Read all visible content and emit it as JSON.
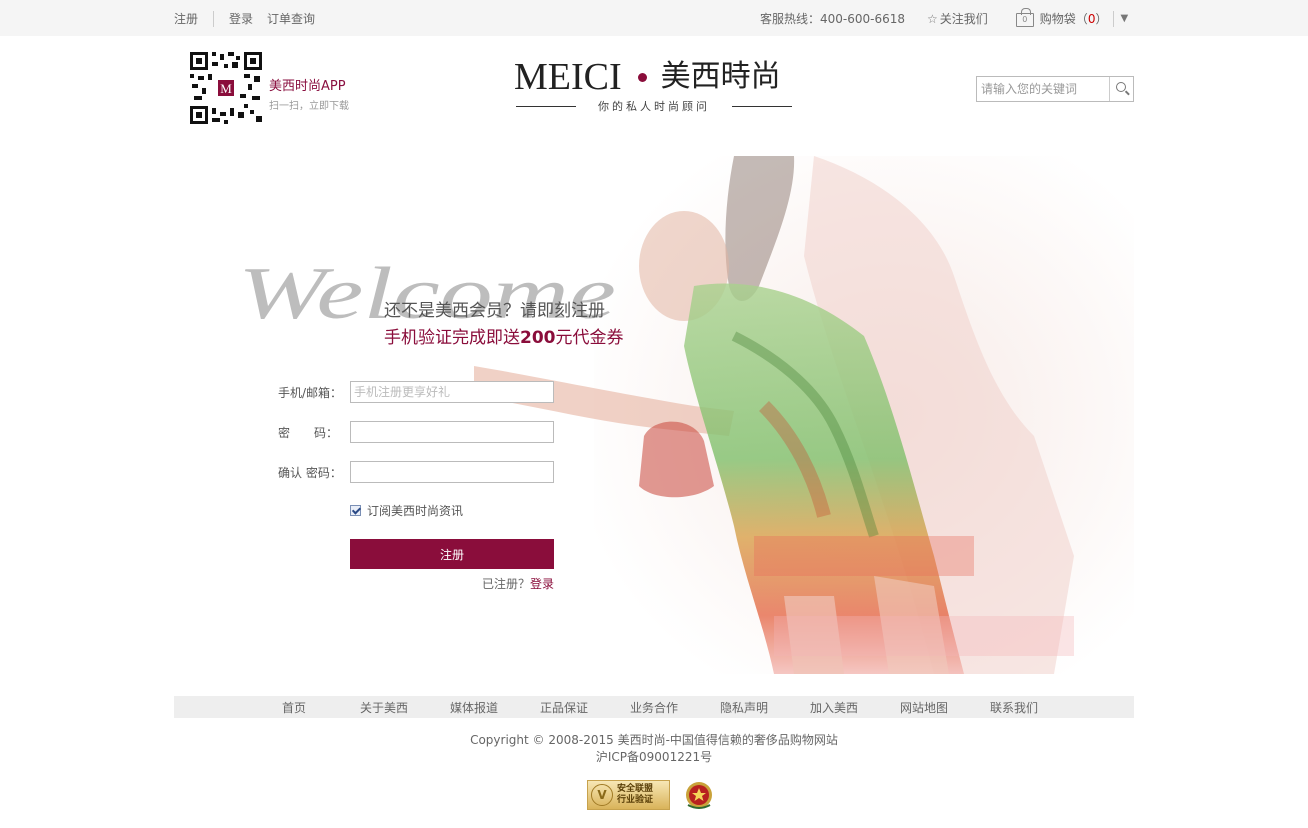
{
  "topbar": {
    "register": "注册",
    "login": "登录",
    "order_query": "订单查询",
    "hotline": "客服热线：400-600-6618",
    "follow": "关注我们",
    "cart_label": "购物袋（",
    "cart_count": "0",
    "cart_close": "）",
    "bag_count": "0"
  },
  "header": {
    "app_title": "美西时尚APP",
    "app_subtitle": "扫一扫，立即下载",
    "qr_letter": "M",
    "logo_en": "MEICI",
    "logo_cn": "美西時尚",
    "logo_tagline": "你的私人时尚顾问",
    "search_placeholder": "请输入您的关键词"
  },
  "hero": {
    "welcome": "Welcome",
    "slogan_1": "还不是美西会员？请即刻注册",
    "slogan_2_pre": "手机验证完成即送",
    "slogan_2_amount": "200",
    "slogan_2_post": "元代金券"
  },
  "form": {
    "account_label": "手机/邮箱：",
    "account_placeholder": "手机注册更享好礼",
    "password_label": "密　　码：",
    "confirm_label": "确认 密码：",
    "subscribe_label": "订阅美西时尚资讯",
    "register_button": "注册",
    "registered_text": "已注册？",
    "login_link": "登录"
  },
  "footer": {
    "nav": [
      "首页",
      "关于美西",
      "媒体报道",
      "正品保证",
      "业务合作",
      "隐私声明",
      "加入美西",
      "网站地图",
      "联系我们"
    ],
    "copyright": "Copyright © 2008-2015 美西时尚-中国值得信赖的奢侈品购物网站",
    "icp": "沪ICP备09001221号",
    "badge_line1": "安全联盟",
    "badge_line2": "行业验证"
  },
  "colors": {
    "brand": "#8a0d3b",
    "topbar_bg": "#f5f5f5",
    "footer_nav_bg": "#eeeeee"
  }
}
